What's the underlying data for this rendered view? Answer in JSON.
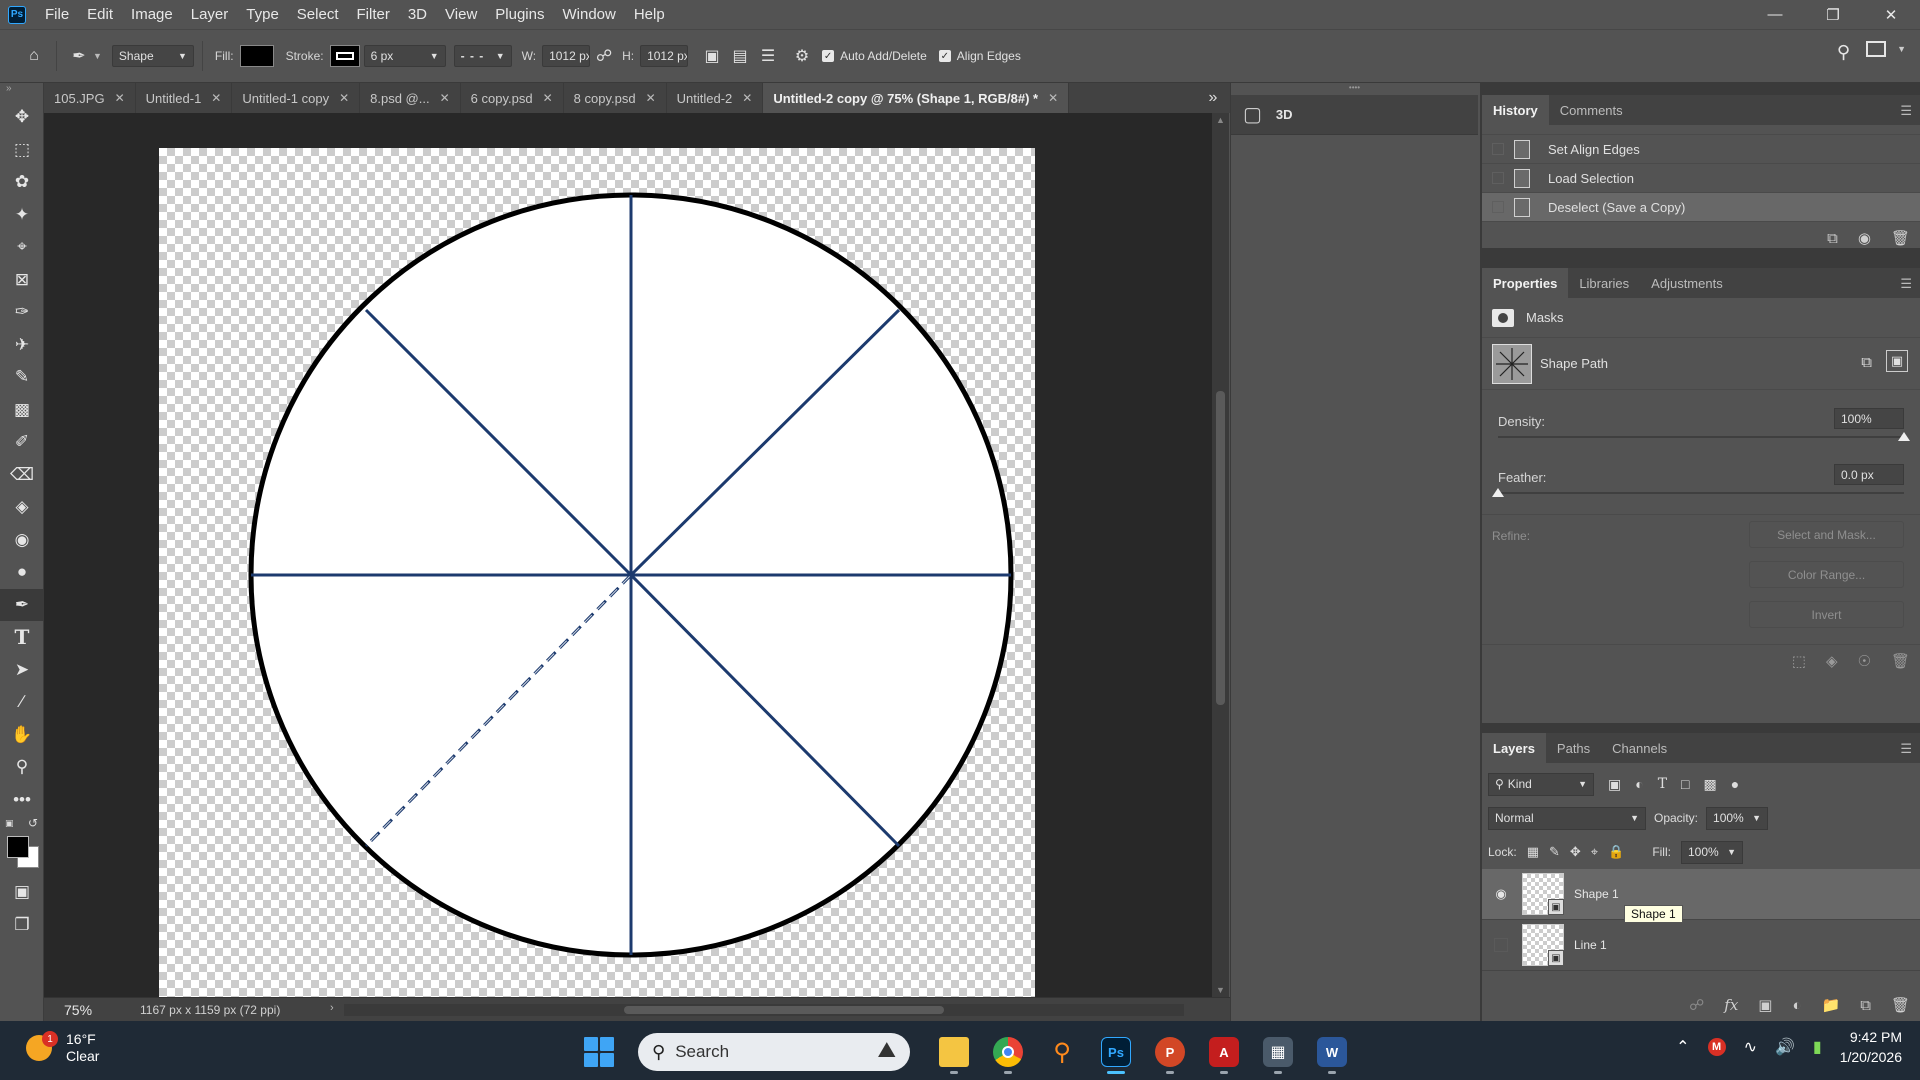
{
  "app": {
    "logo": "Ps"
  },
  "menu": [
    "File",
    "Edit",
    "Image",
    "Layer",
    "Type",
    "Select",
    "Filter",
    "3D",
    "View",
    "Plugins",
    "Window",
    "Help"
  ],
  "options": {
    "mode": "Shape",
    "fill_label": "Fill:",
    "stroke_label": "Stroke:",
    "stroke_size": "6 px",
    "w_label": "W:",
    "w_value": "1012 px",
    "h_label": "H:",
    "h_value": "1012 px",
    "auto_add_delete": "Auto Add/Delete",
    "align_edges": "Align Edges"
  },
  "tabs": [
    {
      "label": "105.JPG"
    },
    {
      "label": "Untitled-1"
    },
    {
      "label": "Untitled-1 copy"
    },
    {
      "label": "8.psd @..."
    },
    {
      "label": "6 copy.psd"
    },
    {
      "label": "8 copy.psd"
    },
    {
      "label": "Untitled-2"
    },
    {
      "label": "Untitled-2 copy @ 75% (Shape 1, RGB/8#) *"
    }
  ],
  "status": {
    "zoom": "75%",
    "doc_info": "1167 px x 1159 px (72 ppi)"
  },
  "panel3d": {
    "title": "3D"
  },
  "history": {
    "tabs": [
      "History",
      "Comments"
    ],
    "items": [
      {
        "label": "Set Align Edges"
      },
      {
        "label": "Load Selection"
      },
      {
        "label": "Deselect (Save a Copy)"
      }
    ]
  },
  "properties": {
    "tabs": [
      "Properties",
      "Libraries",
      "Adjustments"
    ],
    "masks": "Masks",
    "shape_path": "Shape Path",
    "density_label": "Density:",
    "density_value": "100%",
    "density_level": 1.0,
    "feather_label": "Feather:",
    "feather_value": "0.0 px",
    "feather_level": 0.0,
    "refine_label": "Refine:",
    "select_and_mask": "Select and Mask...",
    "color_range": "Color Range...",
    "invert": "Invert"
  },
  "layers": {
    "tabs": [
      "Layers",
      "Paths",
      "Channels"
    ],
    "kind": "Kind",
    "blend_mode": "Normal",
    "opacity_label": "Opacity:",
    "opacity_value": "100%",
    "lock_label": "Lock:",
    "fill_label": "Fill:",
    "fill_value": "100%",
    "items": [
      {
        "name": "Shape 1",
        "visible": true
      },
      {
        "name": "Line 1",
        "visible": false
      }
    ],
    "tooltip": "Shape 1"
  },
  "taskbar": {
    "weather_temp": "16°F",
    "weather_desc": "Clear",
    "weather_badge": "1",
    "search_placeholder": "Search",
    "time": "9:42 PM",
    "date": "1/20/2026"
  },
  "colors": {
    "ps_blue": "#31a8ff",
    "path_blue": "#1c3a6e",
    "taskbar_bg": "#1f2a36"
  }
}
